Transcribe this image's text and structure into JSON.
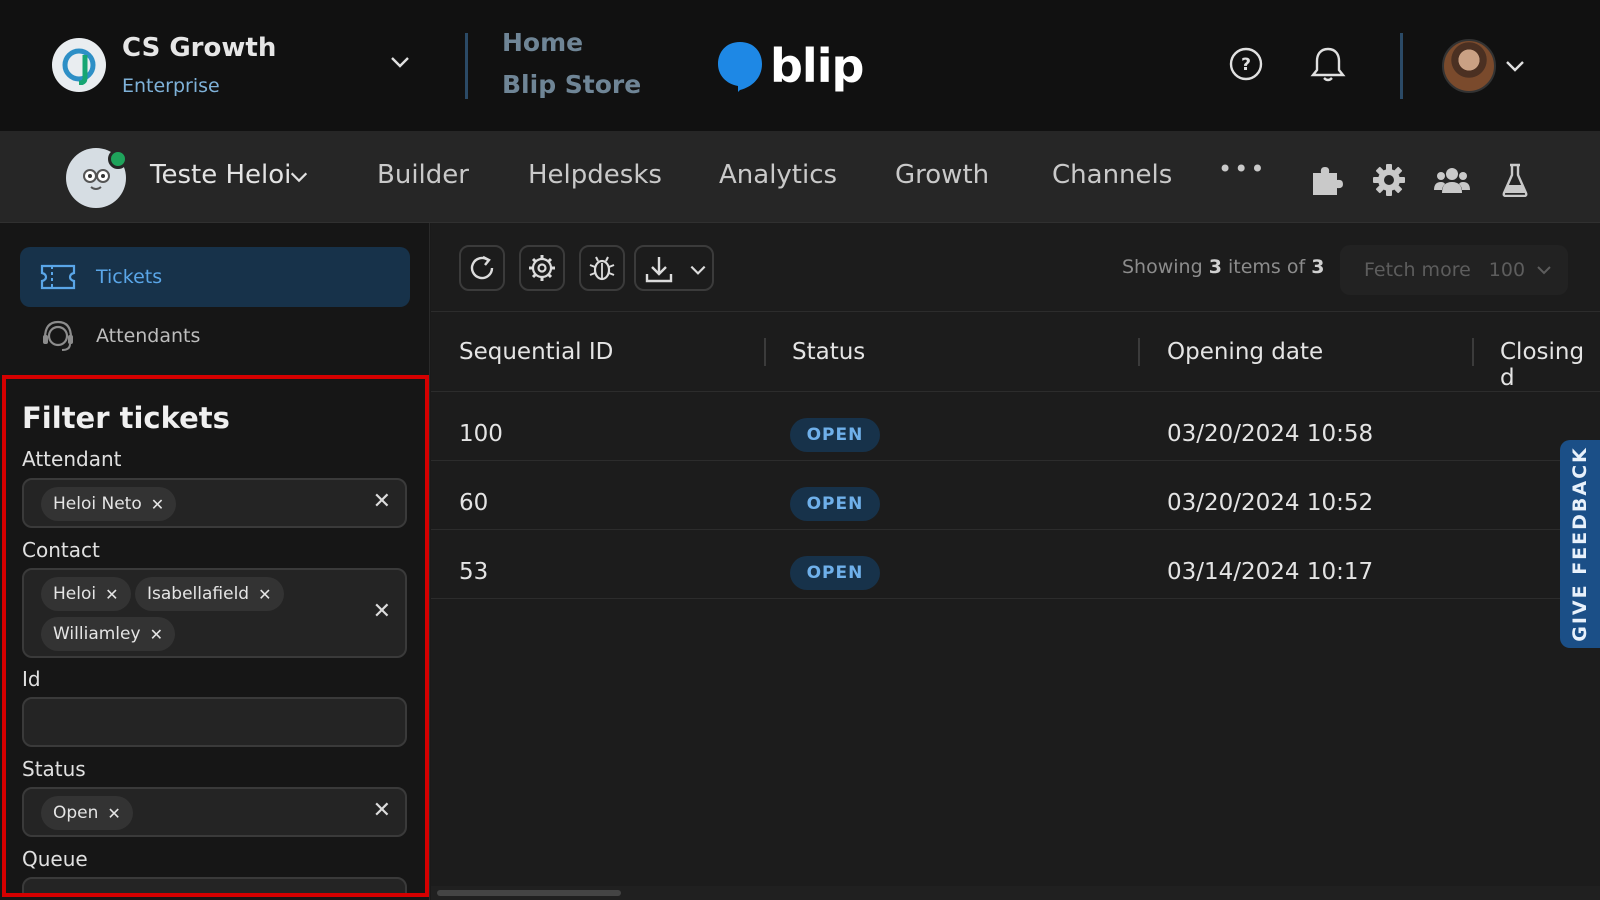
{
  "topbar": {
    "org_name": "CS Growth",
    "org_plan": "Enterprise",
    "home_link": "Home",
    "store_link": "Blip Store",
    "brand": "blip"
  },
  "navbar": {
    "bot_name": "Teste Heloi",
    "items": [
      "Builder",
      "Helpdesks",
      "Analytics",
      "Growth",
      "Channels"
    ],
    "more": "•••"
  },
  "sidebar": {
    "items": [
      {
        "label": "Tickets",
        "icon": "ticket-icon"
      },
      {
        "label": "Attendants",
        "icon": "headset-icon"
      }
    ]
  },
  "filter": {
    "title": "Filter tickets",
    "attendant": {
      "label": "Attendant",
      "chips": [
        "Heloi Neto"
      ]
    },
    "contact": {
      "label": "Contact",
      "chips": [
        "Heloi",
        "Isabellafield",
        "Williamley"
      ]
    },
    "id": {
      "label": "Id",
      "value": ""
    },
    "status": {
      "label": "Status",
      "chips": [
        "Open"
      ]
    },
    "queue": {
      "label": "Queue"
    }
  },
  "toolbar": {
    "showing_prefix": "Showing",
    "showing_count": "3",
    "showing_mid": "items of",
    "showing_total": "3",
    "fetch_label": "Fetch more",
    "fetch_value": "100"
  },
  "table": {
    "columns": [
      "Sequential ID",
      "Status",
      "Opening date",
      "Closing d"
    ],
    "rows": [
      {
        "id": "100",
        "status": "OPEN",
        "opening": "03/20/2024 10:58"
      },
      {
        "id": "60",
        "status": "OPEN",
        "opening": "03/20/2024 10:52"
      },
      {
        "id": "53",
        "status": "OPEN",
        "opening": "03/14/2024 10:17"
      }
    ]
  },
  "feedback": {
    "label": "GIVE FEEDBACK"
  },
  "colors": {
    "accent": "#1b6fc9",
    "active_bg": "#17324a",
    "badge_text": "#6fb0ea",
    "highlight": "#d50000",
    "online": "#1fa35b"
  }
}
